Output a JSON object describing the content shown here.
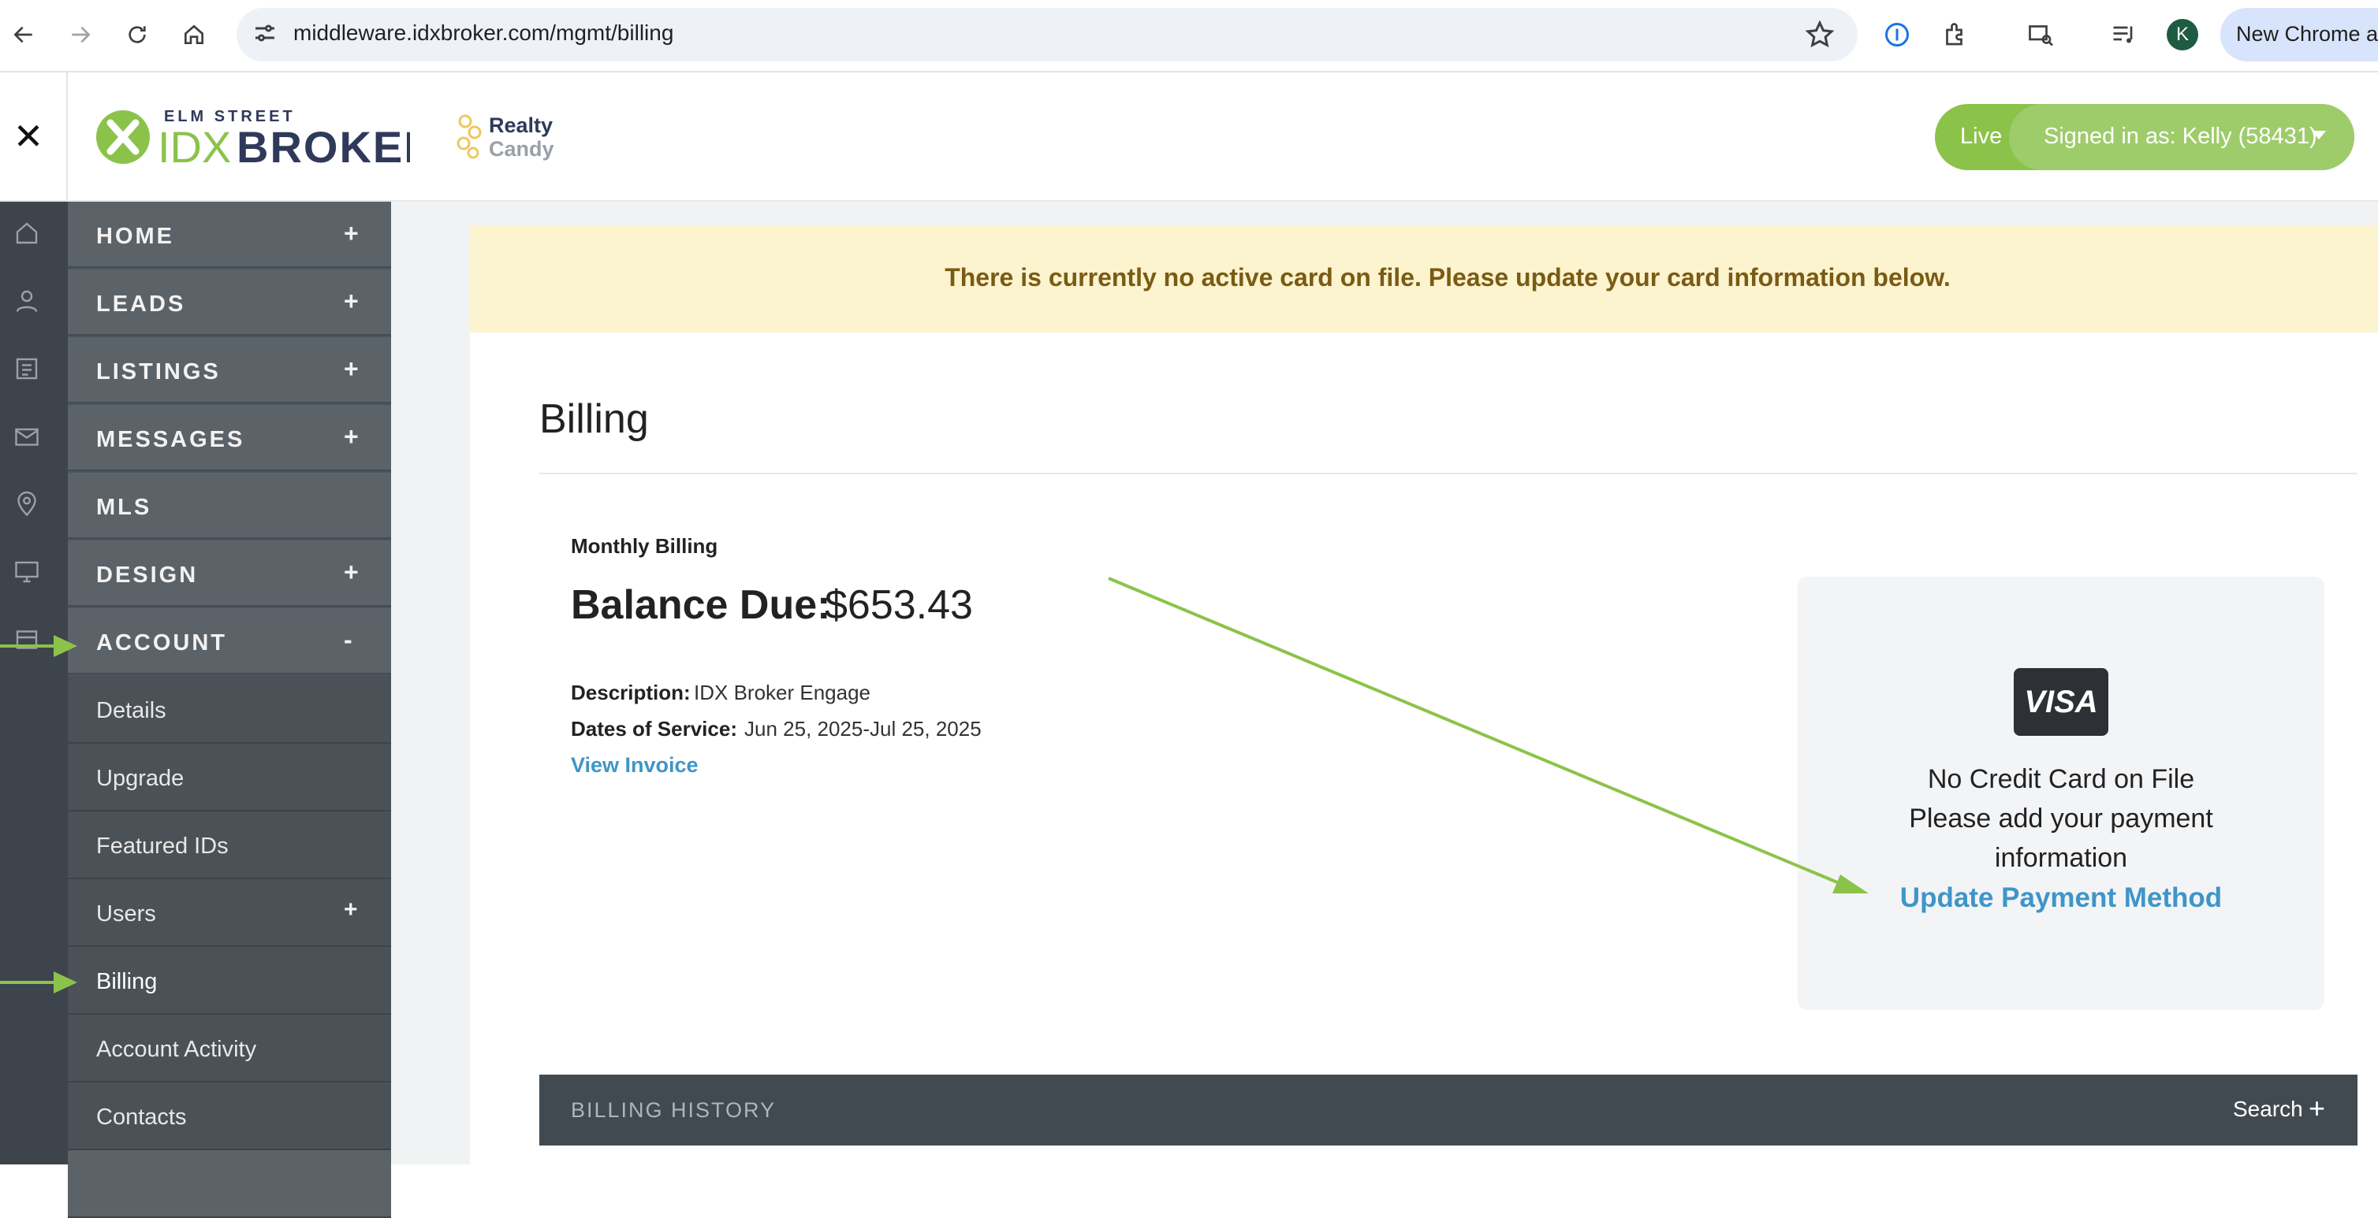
{
  "browser": {
    "url": "middleware.idxbroker.com/mgmt/billing",
    "profile_initial": "K",
    "chrome_button": "New Chrome a"
  },
  "header": {
    "logo_top": "ELM STREET",
    "logo_idx": "IDX",
    "logo_broker": "BROKER",
    "partner_line1": "Realty",
    "partner_line2": "Candy",
    "status_label": "Live",
    "signed_in": "Signed in as: Kelly (58431)"
  },
  "sidebar": {
    "items": [
      {
        "label": "HOME",
        "toggle": "+"
      },
      {
        "label": "LEADS",
        "toggle": "+"
      },
      {
        "label": "LISTINGS",
        "toggle": "+"
      },
      {
        "label": "MESSAGES",
        "toggle": "+"
      },
      {
        "label": "MLS",
        "toggle": ""
      },
      {
        "label": "DESIGN",
        "toggle": "+"
      },
      {
        "label": "ACCOUNT",
        "toggle": "-"
      }
    ],
    "sub_items": [
      {
        "label": "Details",
        "toggle": ""
      },
      {
        "label": "Upgrade",
        "toggle": ""
      },
      {
        "label": "Featured IDs",
        "toggle": ""
      },
      {
        "label": "Users",
        "toggle": "+"
      },
      {
        "label": "Billing",
        "toggle": ""
      },
      {
        "label": "Account Activity",
        "toggle": ""
      },
      {
        "label": "Contacts",
        "toggle": ""
      }
    ]
  },
  "alert": {
    "text": "There is currently no active card on file. Please update your card information below."
  },
  "billing": {
    "title": "Billing",
    "period_label": "Monthly Billing",
    "balance_label": "Balance Due:",
    "balance_value": "$653.43",
    "description_key": "Description:",
    "description_value": "IDX Broker Engage",
    "dates_key": "Dates of Service:",
    "dates_value": "Jun 25, 2025-Jul 25, 2025",
    "view_invoice": "View Invoice"
  },
  "card": {
    "brand": "VISA",
    "line1": "No Credit Card on File",
    "line2": "Please add your payment",
    "line3": "information",
    "update_link": "Update Payment Method"
  },
  "history": {
    "label": "BILLING HISTORY",
    "search": "Search",
    "plus": "+"
  },
  "colors": {
    "accent_green": "#8bc34a",
    "link_blue": "#3f95c8",
    "sidebar": "#4d555c"
  }
}
